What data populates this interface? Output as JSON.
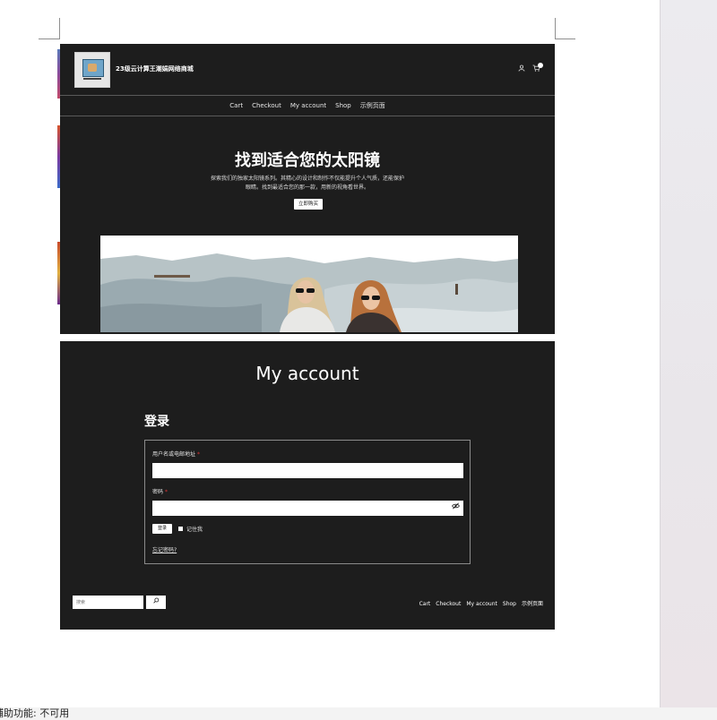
{
  "site": {
    "title": "23级云计算王潮娟网络商城"
  },
  "nav": {
    "items": [
      "Cart",
      "Checkout",
      "My account",
      "Shop",
      "示例页面"
    ]
  },
  "hero": {
    "title": "找到适合您的太阳镜",
    "description": "探索我们的独家太阳镜系列。其精心的设计和制作不仅能提升个人气质，还能保护眼睛。找到最适合您的那一款，用新的视角看世界。",
    "button_label": "立即购买"
  },
  "account": {
    "title": "My account",
    "login_heading": "登录",
    "username_label": "用户名或电邮地址",
    "password_label": "密码",
    "required_mark": "*",
    "login_button": "登录",
    "remember_label": "记住我",
    "lost_password": "忘记密码?"
  },
  "footer": {
    "search_placeholder": "搜索",
    "nav_items": [
      "Cart",
      "Checkout",
      "My account",
      "Shop",
      "示例页面"
    ]
  },
  "status_bar": {
    "text": "辅助功能: 不可用"
  },
  "colors": {
    "page_bg": "#1d1d1d",
    "text": "#ffffff",
    "input_bg": "#ffffff",
    "sidebar": "#ebe8ec"
  },
  "icons": [
    "user-icon",
    "cart-icon",
    "eye-slash-icon",
    "search-icon"
  ]
}
